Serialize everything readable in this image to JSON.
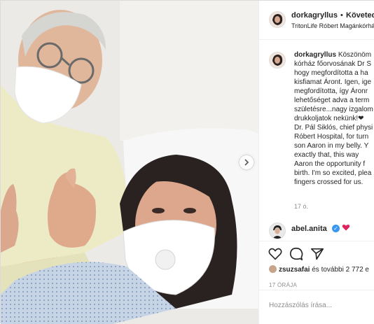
{
  "post": {
    "username": "dorkagryllus",
    "separator": "•",
    "follow_label": "Követed",
    "location": "TritonLife Róbert Magánkórház"
  },
  "caption": {
    "username": "dorkagryllus",
    "lines": [
      "Köszönöm",
      "kórház főorvosának Dr S",
      "hogy megfordította a ha",
      "kisfiamat Áront. Igen, ige",
      "megfordította, így Áronr",
      "lehetőséget adva a term",
      "születésre...nagy izgalom",
      "drukkoljatok nekünk!❤",
      "Dr. Pál Siklós, chief physi",
      "Róbert Hospital, for turn",
      "son Aaron in my belly. Y",
      "exactly that, this way",
      "Aaron the opportunity f",
      "birth. I'm so excited, plea",
      "fingers crossed for us."
    ],
    "time": "17 ó."
  },
  "reply": {
    "username": "abel.anita",
    "verified_mark": "✓"
  },
  "actions": {
    "like_icon": "heart-outline-icon",
    "comment_icon": "comment-bubble-icon",
    "share_icon": "paper-plane-icon"
  },
  "likes": {
    "first_liker": "zsuzsafai",
    "text": "és további 2 772 e"
  },
  "posted_ago": "17 ÓRÁJA",
  "add_comment": {
    "placeholder": "Hozzászólás írása..."
  },
  "colors": {
    "verified": "#3897f0",
    "heart_red": "#e0245e",
    "muted": "#8e8e8e"
  }
}
